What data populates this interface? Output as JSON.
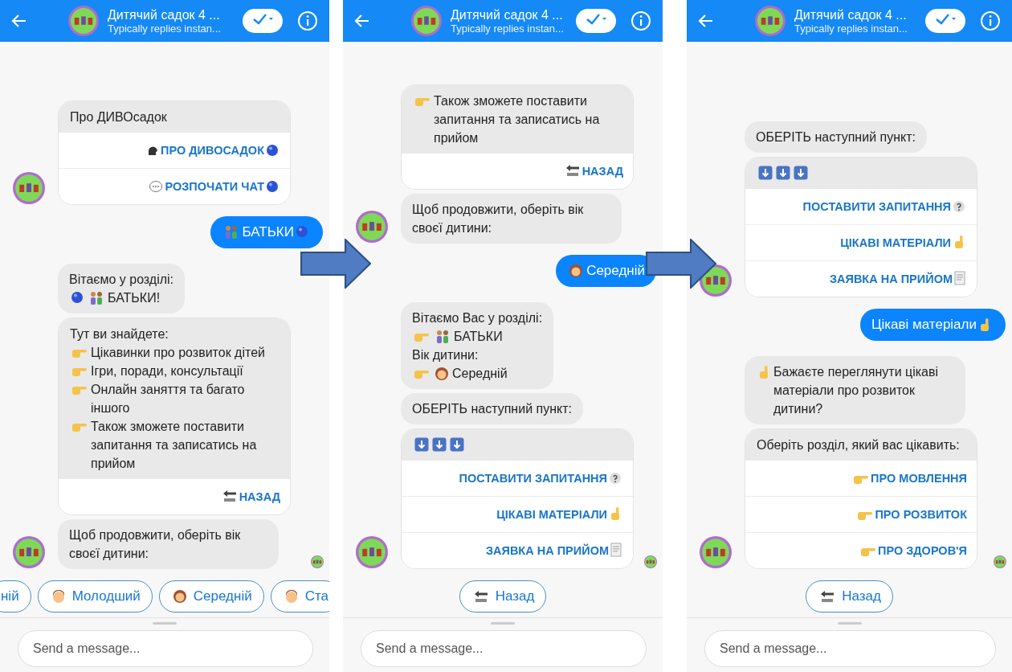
{
  "screens": [
    {
      "header": {
        "title": "Дитячий садок 4 ...",
        "subtitle": "Typically replies instan..."
      },
      "messages": [
        {
          "kind": "card",
          "avatar": true,
          "seen": false,
          "lines": [
            {
              "text": "Про ДИВОсадок"
            }
          ],
          "buttons": [
            {
              "text": "ПРО ДИВОСАДОК",
              "pre": [
                {
                  "kind": "head"
                }
              ],
              "post": [
                {
                  "kind": "ball"
                }
              ]
            },
            {
              "text": "РОЗПОЧАТИ ЧАТ",
              "pre": [
                {
                  "kind": "chat"
                }
              ],
              "post": [
                {
                  "kind": "ball"
                }
              ]
            }
          ]
        },
        {
          "kind": "user",
          "lines": [
            {
              "text": "БАТЬКИ",
              "pre": [
                {
                  "kind": "people"
                }
              ],
              "post": [
                {
                  "kind": "ball"
                }
              ]
            }
          ]
        },
        {
          "kind": "bot",
          "avatar": false,
          "seen": false,
          "lines": [
            {
              "text": "Вітаємо у розділі:"
            },
            {
              "text": "БАТЬКИ!",
              "pre": [
                {
                  "kind": "ball"
                },
                {
                  "kind": "people"
                }
              ]
            }
          ]
        },
        {
          "kind": "card",
          "avatar": false,
          "seen": false,
          "lines": [
            {
              "text": "Тут ви знайдете:"
            },
            {
              "text": "Цікавинки про розвиток дітей",
              "pre": [
                {
                  "kind": "pointer"
                }
              ]
            },
            {
              "text": "Ігри, поради, консультації",
              "pre": [
                {
                  "kind": "pointer"
                }
              ]
            },
            {
              "text": "Онлайн заняття та багато іншого",
              "pre": [
                {
                  "kind": "pointer"
                }
              ]
            },
            {
              "text": "Також зможете поставити запитання та записатись на прийом",
              "pre": [
                {
                  "kind": "pointer"
                }
              ]
            }
          ],
          "buttons": [
            {
              "text": "НАЗАД",
              "pre": [
                {
                  "kind": "back"
                }
              ]
            }
          ]
        },
        {
          "kind": "bot",
          "avatar": true,
          "seen": true,
          "lines": [
            {
              "text": "Щоб продовжити, оберіть вік своєї дитини:"
            }
          ]
        }
      ],
      "quick_replies": [
        {
          "text": "ній"
        },
        {
          "text": "Молодший",
          "pre": [
            {
              "kind": "boy"
            }
          ]
        },
        {
          "text": "Середній",
          "pre": [
            {
              "kind": "woman"
            }
          ]
        },
        {
          "text": "Ста",
          "pre": [
            {
              "kind": "boy"
            }
          ]
        }
      ],
      "composer": {
        "placeholder": "Send a message..."
      }
    },
    {
      "header": {
        "title": "Дитячий садок 4 ...",
        "subtitle": "Typically replies instan..."
      },
      "messages": [
        {
          "kind": "card",
          "avatar": false,
          "seen": false,
          "lines": [
            {
              "text": "Також зможете поставити запитання та записатись на прийом",
              "pre": [
                {
                  "kind": "pointer"
                }
              ]
            }
          ],
          "buttons": [
            {
              "text": "НАЗАД",
              "pre": [
                {
                  "kind": "back"
                }
              ]
            }
          ]
        },
        {
          "kind": "bot",
          "avatar": true,
          "seen": false,
          "lines": [
            {
              "text": "Щоб продовжити, оберіть вік своєї дитини:"
            }
          ]
        },
        {
          "kind": "user",
          "lines": [
            {
              "text": "Середній",
              "pre": [
                {
                  "kind": "woman"
                }
              ]
            }
          ]
        },
        {
          "kind": "bot",
          "avatar": false,
          "seen": false,
          "lines": [
            {
              "text": "Вітаємо Вас у розділі:"
            },
            {
              "text": "БАТЬКИ",
              "pre": [
                {
                  "kind": "pointer"
                },
                {
                  "kind": "people"
                }
              ]
            },
            {
              "text": "Вік дитини:"
            },
            {
              "text": "Середній",
              "pre": [
                {
                  "kind": "pointer"
                },
                {
                  "kind": "woman"
                }
              ]
            }
          ]
        },
        {
          "kind": "bot",
          "avatar": false,
          "seen": false,
          "lines": [
            {
              "text": "ОБЕРІТЬ наступний пункт:"
            }
          ]
        },
        {
          "kind": "card",
          "avatar": true,
          "seen": true,
          "header_icons": [
            {
              "kind": "down"
            },
            {
              "kind": "down"
            },
            {
              "kind": "down"
            }
          ],
          "buttons": [
            {
              "text": "ПОСТАВИТИ ЗАПИТАННЯ",
              "post": [
                {
                  "kind": "question"
                }
              ]
            },
            {
              "text": "ЦІКАВІ МАТЕРІАЛИ",
              "post": [
                {
                  "kind": "finger"
                }
              ]
            },
            {
              "text": "ЗАЯВКА НА ПРИЙОМ",
              "post": [
                {
                  "kind": "doc"
                }
              ]
            }
          ]
        }
      ],
      "quick_replies": [
        {
          "text": "Назад",
          "pre": [
            {
              "kind": "back"
            }
          ]
        }
      ],
      "composer": {
        "placeholder": "Send a message..."
      }
    },
    {
      "header": {
        "title": "Дитячий садок 4 ...",
        "subtitle": "Typically replies instan..."
      },
      "messages": [
        {
          "kind": "bot",
          "avatar": false,
          "seen": false,
          "lines": [
            {
              "text": "ОБЕРІТЬ наступний пункт:"
            }
          ]
        },
        {
          "kind": "card",
          "avatar": true,
          "seen": false,
          "header_icons": [
            {
              "kind": "down"
            },
            {
              "kind": "down"
            },
            {
              "kind": "down"
            }
          ],
          "buttons": [
            {
              "text": "ПОСТАВИТИ ЗАПИТАННЯ",
              "post": [
                {
                  "kind": "question"
                }
              ]
            },
            {
              "text": "ЦІКАВІ МАТЕРІАЛИ",
              "post": [
                {
                  "kind": "finger"
                }
              ]
            },
            {
              "text": "ЗАЯВКА НА ПРИЙОМ",
              "post": [
                {
                  "kind": "doc"
                }
              ]
            }
          ]
        },
        {
          "kind": "user",
          "lines": [
            {
              "text": "Цікаві матеріали",
              "post": [
                {
                  "kind": "finger"
                }
              ]
            }
          ]
        },
        {
          "kind": "bot",
          "avatar": false,
          "seen": false,
          "lines": [
            {
              "text": "Бажаєте переглянути цікаві матеріали про розвиток дитини?",
              "pre": [
                {
                  "kind": "finger"
                }
              ]
            }
          ]
        },
        {
          "kind": "card",
          "avatar": true,
          "seen": true,
          "lines": [
            {
              "text": "Оберіть розділ, який вас цікавить:"
            }
          ],
          "buttons": [
            {
              "text": "ПРО МОВЛЕННЯ",
              "pre": [
                {
                  "kind": "pointer"
                }
              ]
            },
            {
              "text": "ПРО РОЗВИТОК",
              "pre": [
                {
                  "kind": "pointer"
                }
              ]
            },
            {
              "text": "ПРО ЗДОРОВ'Я",
              "pre": [
                {
                  "kind": "pointer"
                }
              ]
            }
          ]
        }
      ],
      "quick_replies": [
        {
          "text": "Назад",
          "pre": [
            {
              "kind": "back"
            }
          ]
        }
      ],
      "composer": {
        "placeholder": "Send a message..."
      }
    }
  ]
}
